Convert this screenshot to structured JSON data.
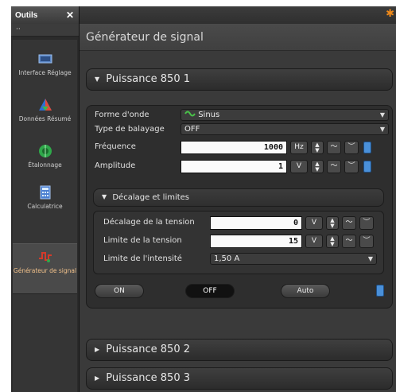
{
  "sidebar": {
    "title": "Outils",
    "close": "✕",
    "sub": "··",
    "items": [
      {
        "label": "Interface Réglage"
      },
      {
        "label": "Données Résumé"
      },
      {
        "label": "Étalonnage"
      },
      {
        "label": "Calculatrice"
      },
      {
        "label": "Générateur de signal"
      }
    ]
  },
  "main": {
    "title": "Générateur de signal",
    "sections": {
      "p1": "Puissance 850 1",
      "p2": "Puissance 850 2",
      "p3": "Puissance 850 3"
    },
    "form": {
      "waveform_label": "Forme d'onde",
      "waveform_value": "Sinus",
      "sweep_label": "Type de balayage",
      "sweep_value": "OFF",
      "freq_label": "Fréquence",
      "freq_value": "1000",
      "freq_unit": "Hz",
      "amp_label": "Amplitude",
      "amp_value": "1",
      "amp_unit": "V",
      "sub_title": "Décalage et limites",
      "offset_label": "Décalage de la tension",
      "offset_value": "0",
      "offset_unit": "V",
      "vlimit_label": "Limite de la tension",
      "vlimit_value": "15",
      "vlimit_unit": "V",
      "ilimit_label": "Limite de l'intensité",
      "ilimit_value": "1,50 A"
    },
    "buttons": {
      "on": "ON",
      "off": "OFF",
      "auto": "Auto"
    }
  },
  "colors": {
    "accent": "#4a90d9",
    "star": "#f08a1a",
    "sine": "#49c149"
  }
}
